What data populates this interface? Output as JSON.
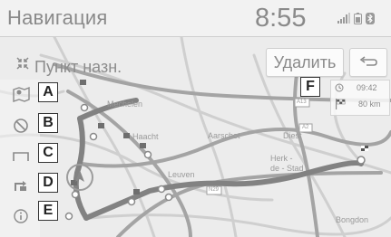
{
  "status_bar": {
    "title": "Навигация",
    "clock": "8:55"
  },
  "destination": {
    "label": "Пункт назн."
  },
  "buttons": {
    "delete_label": "Удалить",
    "back_icon": "back-arrow-icon"
  },
  "sidebar": {
    "items": [
      {
        "icon": "map-pin-list-icon",
        "callout": "A"
      },
      {
        "icon": "cancel-circle-icon",
        "callout": "B"
      },
      {
        "icon": "route-bracket-icon",
        "callout": "C"
      },
      {
        "icon": "detour-icon",
        "callout": "D"
      },
      {
        "icon": "info-icon",
        "callout": "E"
      }
    ]
  },
  "route_panel": {
    "callout": "F",
    "arrival_time": "09:42",
    "distance": "80 km"
  },
  "map_labels": {
    "mechelen": "Mechelen",
    "haacht": "Haacht",
    "aarschot": "Aarschot",
    "diest": "Diest",
    "herk": "Herk -",
    "herk2": "de - Stad",
    "leuven": "Leuven",
    "bouillon": "Bongdon",
    "a13": "A13",
    "a2": "A2",
    "n29": "N29"
  },
  "colors": {
    "road_main": "#9a9a9a",
    "road_minor": "#c8c8c8",
    "route": "#7f7f7f",
    "text": "#8a8a8a"
  }
}
